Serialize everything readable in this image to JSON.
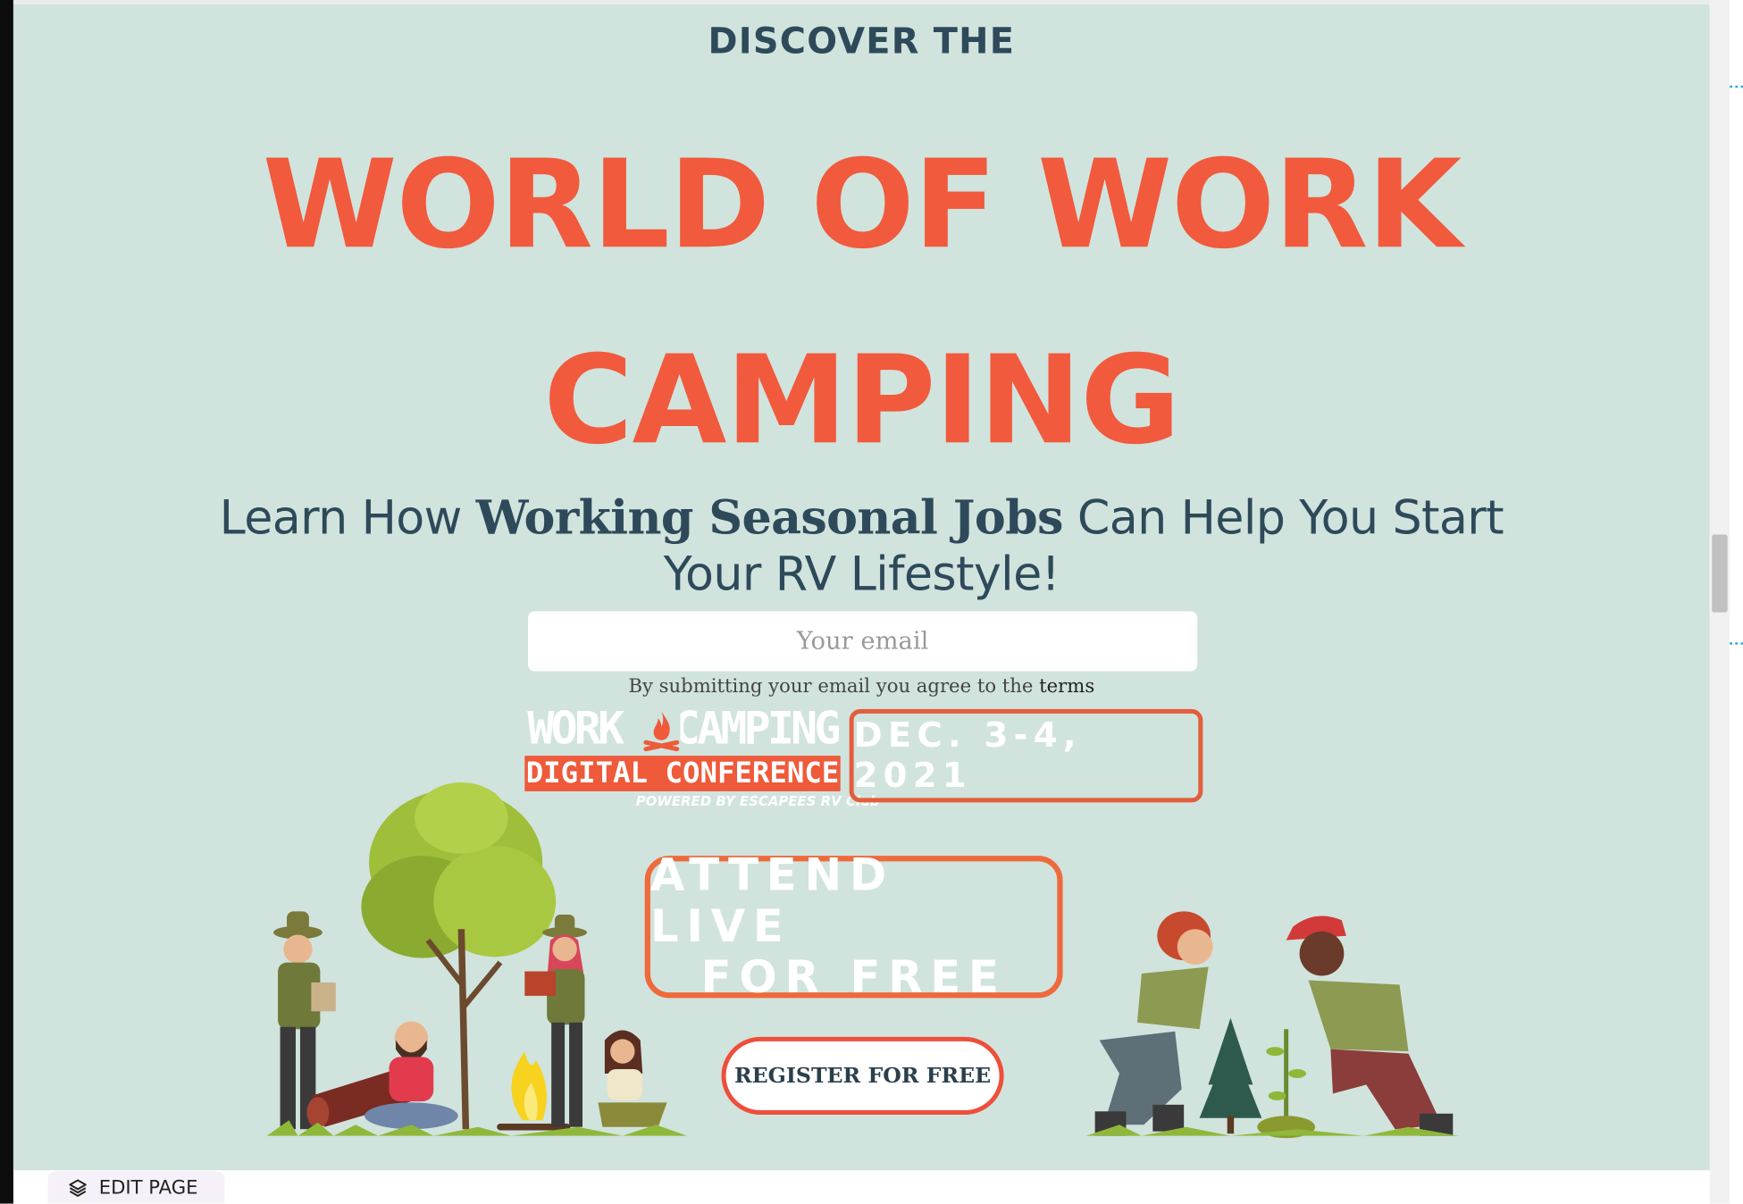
{
  "hero": {
    "eyebrow": "DISCOVER THE",
    "headline_line1": "WORLD OF WORK",
    "headline_line2": "CAMPING",
    "subhead_prefix": "Learn How ",
    "subhead_bold": "Working Seasonal Jobs",
    "subhead_suffix": " Can Help You Start Your RV Lifestyle!",
    "colors": {
      "background": "#d1e3dd",
      "headline": "#f15a3d",
      "text": "#2e4a5a",
      "accent_border": "#ee5a3a"
    }
  },
  "form": {
    "email_placeholder": "Your email",
    "terms_prefix": "By submitting your email you agree to the ",
    "terms_link": "terms",
    "register_label": "REGISTER FOR FREE"
  },
  "logo": {
    "line1": "WORK CAMPING",
    "line2": "DIGITAL CONFERENCE",
    "powered": "POWERED BY ESCAPEES RV Club",
    "icon": "campfire-icon"
  },
  "event": {
    "date": "DEC. 3-4, 2021",
    "attend_line1": "ATTEND LIVE",
    "attend_line2": "FOR FREE"
  },
  "editor": {
    "edit_page_label": "EDIT PAGE",
    "edit_icon": "layers-icon"
  }
}
